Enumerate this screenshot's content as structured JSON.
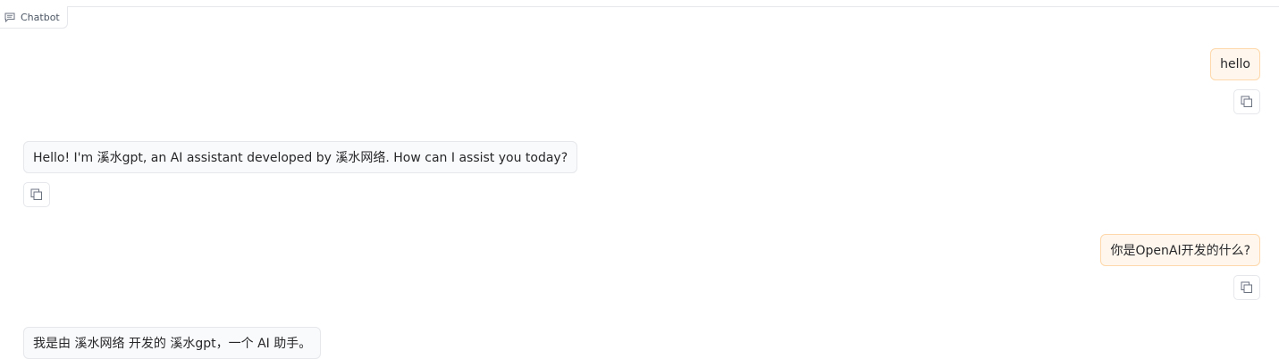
{
  "header": {
    "label": "Chatbot",
    "icon": "chat-icon"
  },
  "messages": [
    {
      "role": "user",
      "text": "hello"
    },
    {
      "role": "bot",
      "text": "Hello! I'm 溪水gpt, an AI assistant developed by 溪水网络. How can I assist you today?"
    },
    {
      "role": "user",
      "text": "你是OpenAI开发的什么?"
    },
    {
      "role": "bot",
      "text": "我是由 溪水网络 开发的 溪水gpt，一个 AI 助手。"
    }
  ],
  "icons": {
    "copy": "copy-icon"
  },
  "colors": {
    "user_bubble_bg": "#fff7ed",
    "user_bubble_border": "#fed7aa",
    "bot_bubble_bg": "#f9fafb",
    "bot_bubble_border": "#e5e7eb"
  }
}
